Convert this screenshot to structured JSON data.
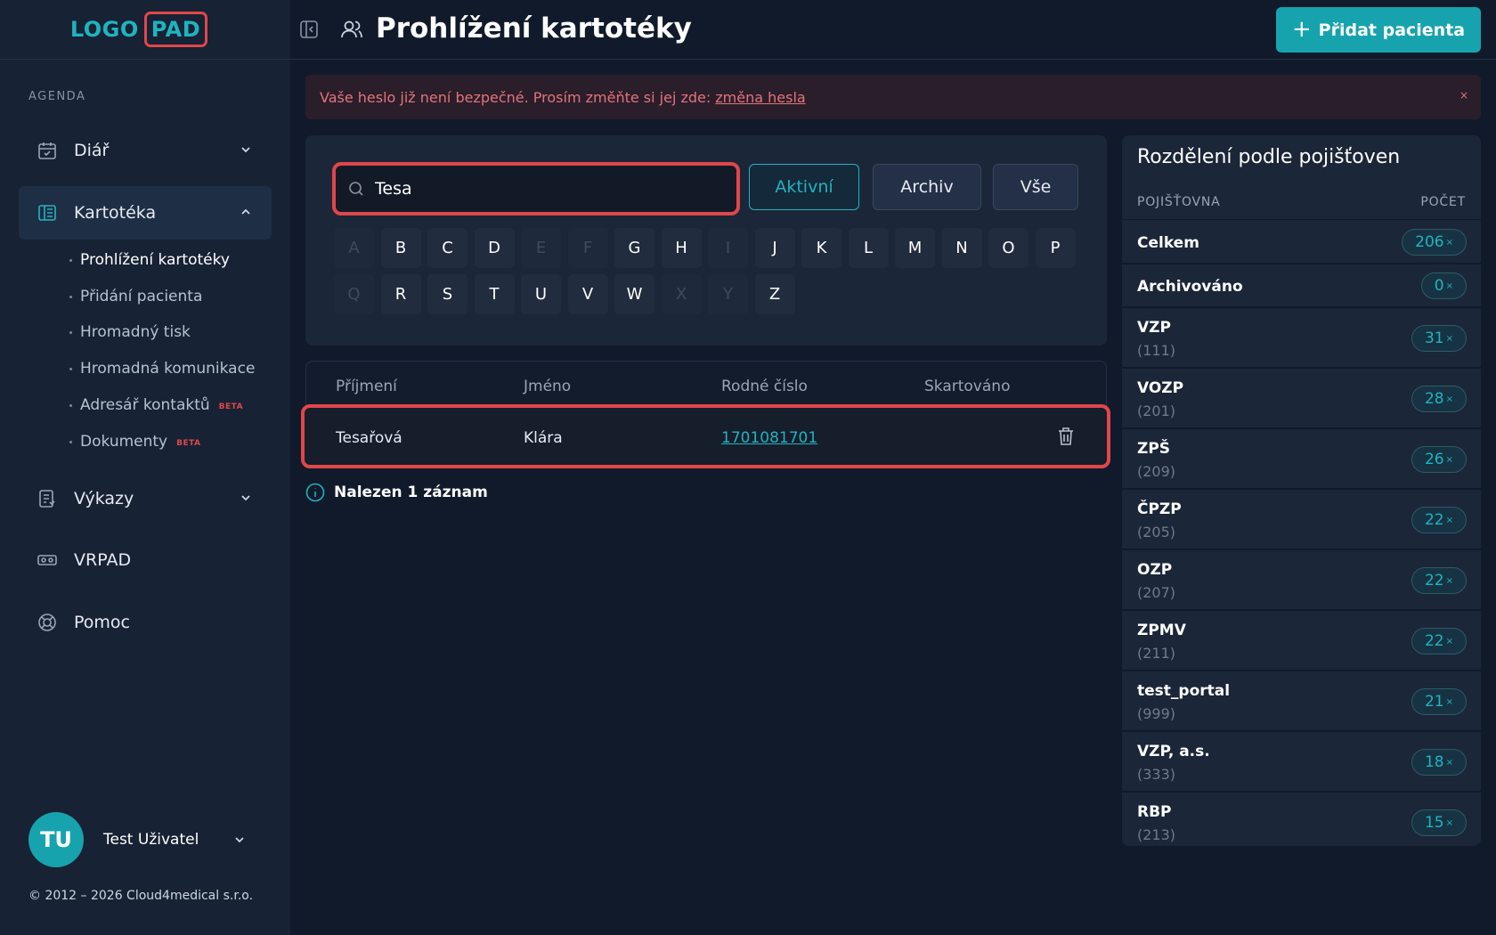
{
  "logo": {
    "part1": "LOGO",
    "part2": "PAD"
  },
  "sidebar": {
    "section_label": "AGENDA",
    "items": [
      {
        "label": "Diář"
      },
      {
        "label": "Kartotéka"
      },
      {
        "label": "Výkazy"
      },
      {
        "label": "VRPAD"
      },
      {
        "label": "Pomoc"
      }
    ],
    "subitems": [
      {
        "label": "Prohlížení kartotéky"
      },
      {
        "label": "Přidání pacienta"
      },
      {
        "label": "Hromadný tisk"
      },
      {
        "label": "Hromadná komunikace"
      },
      {
        "label": "Adresář kontaktů",
        "badge": "BETA"
      },
      {
        "label": "Dokumenty",
        "badge": "BETA"
      }
    ],
    "user": {
      "initials": "TU",
      "name": "Test Uživatel"
    },
    "copyright": "© 2012 – 2026 Cloud4medical s.r.o."
  },
  "header": {
    "title": "Prohlížení kartotéky",
    "add_button": "Přidat pacienta",
    "add_icon": "+"
  },
  "alert": {
    "text": "Vaše heslo již není bezpečné. Prosím změňte si jej zde:",
    "link": "změna hesla",
    "close": "×"
  },
  "search": {
    "value": "Tesa",
    "filters": [
      "Aktivní",
      "Archiv",
      "Vše"
    ],
    "letters_row1": [
      "A",
      "B",
      "C",
      "D",
      "E",
      "F",
      "G",
      "H",
      "I",
      "J",
      "K",
      "L",
      "M",
      "N",
      "O",
      "P"
    ],
    "letters_row2": [
      "Q",
      "R",
      "S",
      "T",
      "U",
      "V",
      "W",
      "X",
      "Y",
      "Z"
    ],
    "disabled_letters": [
      "A",
      "E",
      "F",
      "I",
      "Q",
      "X",
      "Y"
    ]
  },
  "table": {
    "headers": [
      "Příjmení",
      "Jméno",
      "Rodné číslo",
      "Skartováno"
    ],
    "rows": [
      {
        "surname": "Tesařová",
        "name": "Klára",
        "birth_number": "1701081701",
        "shredded": ""
      }
    ],
    "result_text": "Nalezen 1 záznam"
  },
  "insurance": {
    "title": "Rozdělení podle pojišťoven",
    "col_company": "POJIŠŤOVNA",
    "col_count": "POČET",
    "count_suffix": "×",
    "rows": [
      {
        "name": "Celkem",
        "code": "",
        "count": "206"
      },
      {
        "name": "Archivováno",
        "code": "",
        "count": "0"
      },
      {
        "name": "VZP",
        "code": "(111)",
        "count": "31"
      },
      {
        "name": "VOZP",
        "code": "(201)",
        "count": "28"
      },
      {
        "name": "ZPŠ",
        "code": "(209)",
        "count": "26"
      },
      {
        "name": "ČPZP",
        "code": "(205)",
        "count": "22"
      },
      {
        "name": "OZP",
        "code": "(207)",
        "count": "22"
      },
      {
        "name": "ZPMV",
        "code": "(211)",
        "count": "22"
      },
      {
        "name": "test_portal",
        "code": "(999)",
        "count": "21"
      },
      {
        "name": "VZP, a.s.",
        "code": "(333)",
        "count": "18"
      },
      {
        "name": "RBP",
        "code": "(213)",
        "count": "15"
      }
    ]
  },
  "colors": {
    "accent": "#16a3ae",
    "danger": "#e0474a",
    "background": "#111a2b",
    "sidebar": "#172234"
  }
}
